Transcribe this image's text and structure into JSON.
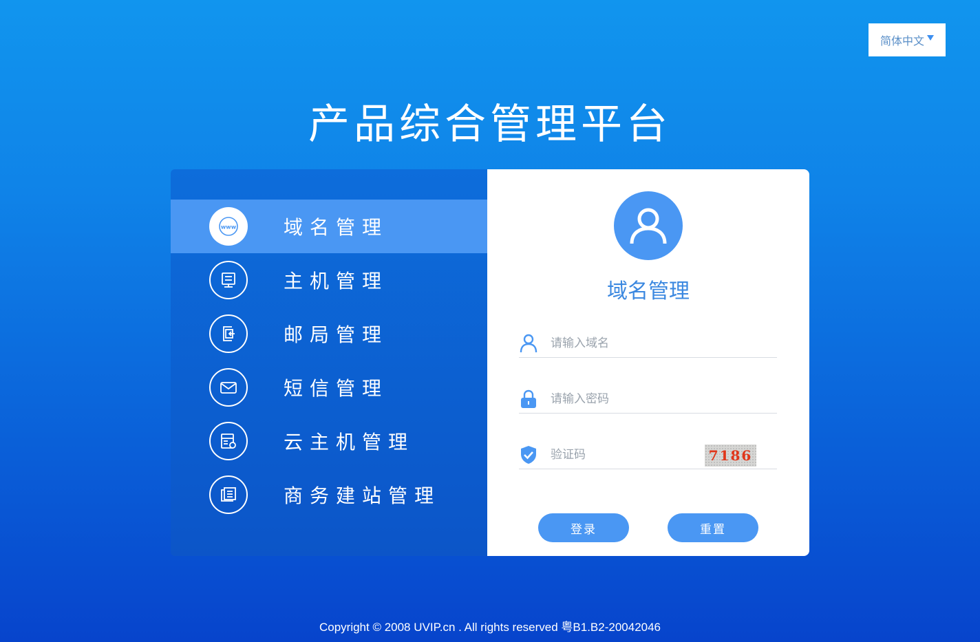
{
  "language": {
    "selected": "简体中文"
  },
  "page_title": "产品综合管理平台",
  "menu": {
    "items": [
      {
        "label": "域名管理",
        "icon": "www-icon",
        "active": true
      },
      {
        "label": "主机管理",
        "icon": "server-icon",
        "active": false
      },
      {
        "label": "邮局管理",
        "icon": "mail-box-icon",
        "active": false
      },
      {
        "label": "短信管理",
        "icon": "envelope-icon",
        "active": false
      },
      {
        "label": "云主机管理",
        "icon": "cloud-server-icon",
        "active": false
      },
      {
        "label": "商务建站管理",
        "icon": "site-builder-icon",
        "active": false
      }
    ]
  },
  "login": {
    "title": "域名管理",
    "domain_placeholder": "请输入域名",
    "password_placeholder": "请输入密码",
    "captcha_placeholder": "验证码",
    "captcha_text": "7186",
    "login_label": "登录",
    "reset_label": "重置"
  },
  "footer": {
    "copyright": "Copyright © 2008 UVIP.cn . All rights reserved 粤B1.B2-20042046"
  },
  "colors": {
    "accent": "#4a97f3",
    "title_blue": "#3b88e0",
    "captcha_red": "#e0361a"
  }
}
